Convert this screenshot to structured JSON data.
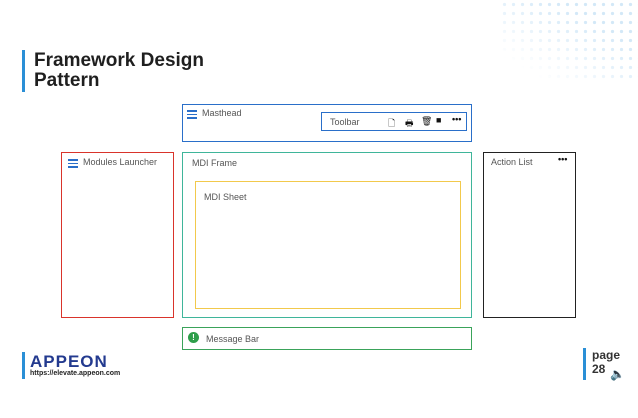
{
  "title": "Framework Design\nPattern",
  "masthead": {
    "label": "Masthead"
  },
  "toolbar": {
    "label": "Toolbar"
  },
  "modules_launcher": {
    "label": "Modules Launcher"
  },
  "mdi_frame": {
    "label": "MDI Frame"
  },
  "mdi_sheet": {
    "label": "MDI Sheet"
  },
  "action_list": {
    "label": "Action List"
  },
  "message_bar": {
    "label": "Message Bar"
  },
  "logo": {
    "text": "APPEON",
    "url": "https://elevate.appeon.com"
  },
  "page": {
    "label": "page",
    "number": "28"
  },
  "colors": {
    "accent": "#2a8fd6",
    "masthead_border": "#2a6fc9",
    "launcher_border": "#d9342b",
    "frame_border": "#3fb59a",
    "sheet_border": "#f2c94c",
    "message_border": "#3aa35a",
    "action_border": "#222222"
  }
}
